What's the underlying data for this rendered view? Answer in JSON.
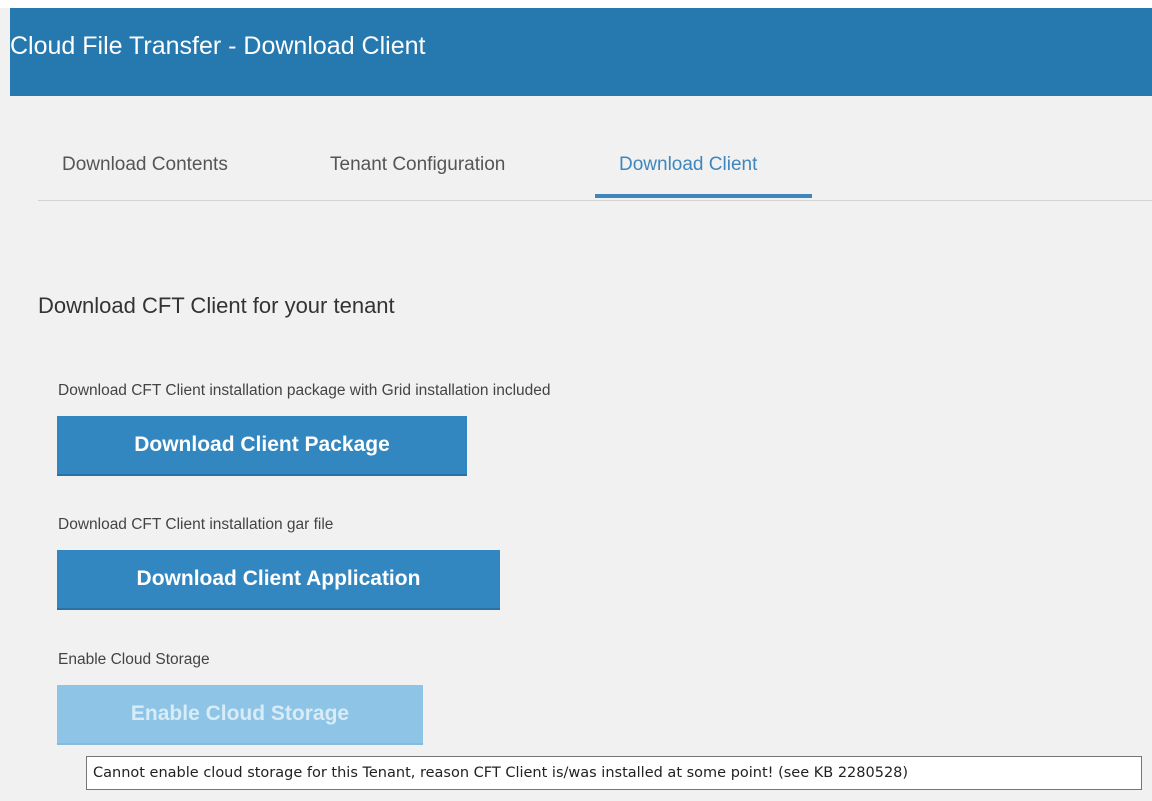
{
  "header": {
    "title": "Cloud File Transfer - Download Client",
    "background_color": "#2679ae"
  },
  "tabs": [
    {
      "label": "Download Contents",
      "active": false
    },
    {
      "label": "Tenant Configuration",
      "active": false
    },
    {
      "label": "Download Client",
      "active": true
    }
  ],
  "accent_color": "#3f86bd",
  "main": {
    "heading": "Download CFT Client for your tenant",
    "sections": [
      {
        "label": "Download CFT Client installation package with Grid installation included",
        "button": "Download Client Package",
        "enabled": true
      },
      {
        "label": "Download CFT Client installation gar file",
        "button": "Download Client Application",
        "enabled": true
      },
      {
        "label": "Enable Cloud Storage",
        "button": "Enable Cloud Storage",
        "enabled": false
      }
    ]
  },
  "tooltip": {
    "text": "Cannot enable cloud storage for this Tenant, reason CFT Client is/was installed at some point! (see KB 2280528)"
  }
}
